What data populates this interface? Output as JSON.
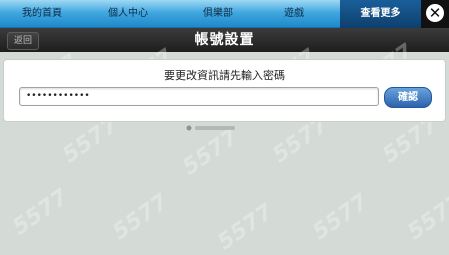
{
  "nav": {
    "tabs": [
      {
        "label": "我的首頁"
      },
      {
        "label": "個人中心"
      },
      {
        "label": "俱樂部"
      },
      {
        "label": "遊戲"
      },
      {
        "label": "查看更多"
      }
    ]
  },
  "header": {
    "back_label": "返回",
    "title": "帳號設置"
  },
  "form": {
    "prompt": "要更改資訊請先輸入密碼",
    "password_value": "••••••••••••",
    "confirm_label": "確認"
  },
  "colors": {
    "nav_blue": "#3fa7df",
    "title_bar": "#2b2b2b",
    "button_blue": "#2a63ad",
    "background": "#d4dad6"
  },
  "icons": {
    "close": "close-icon"
  }
}
